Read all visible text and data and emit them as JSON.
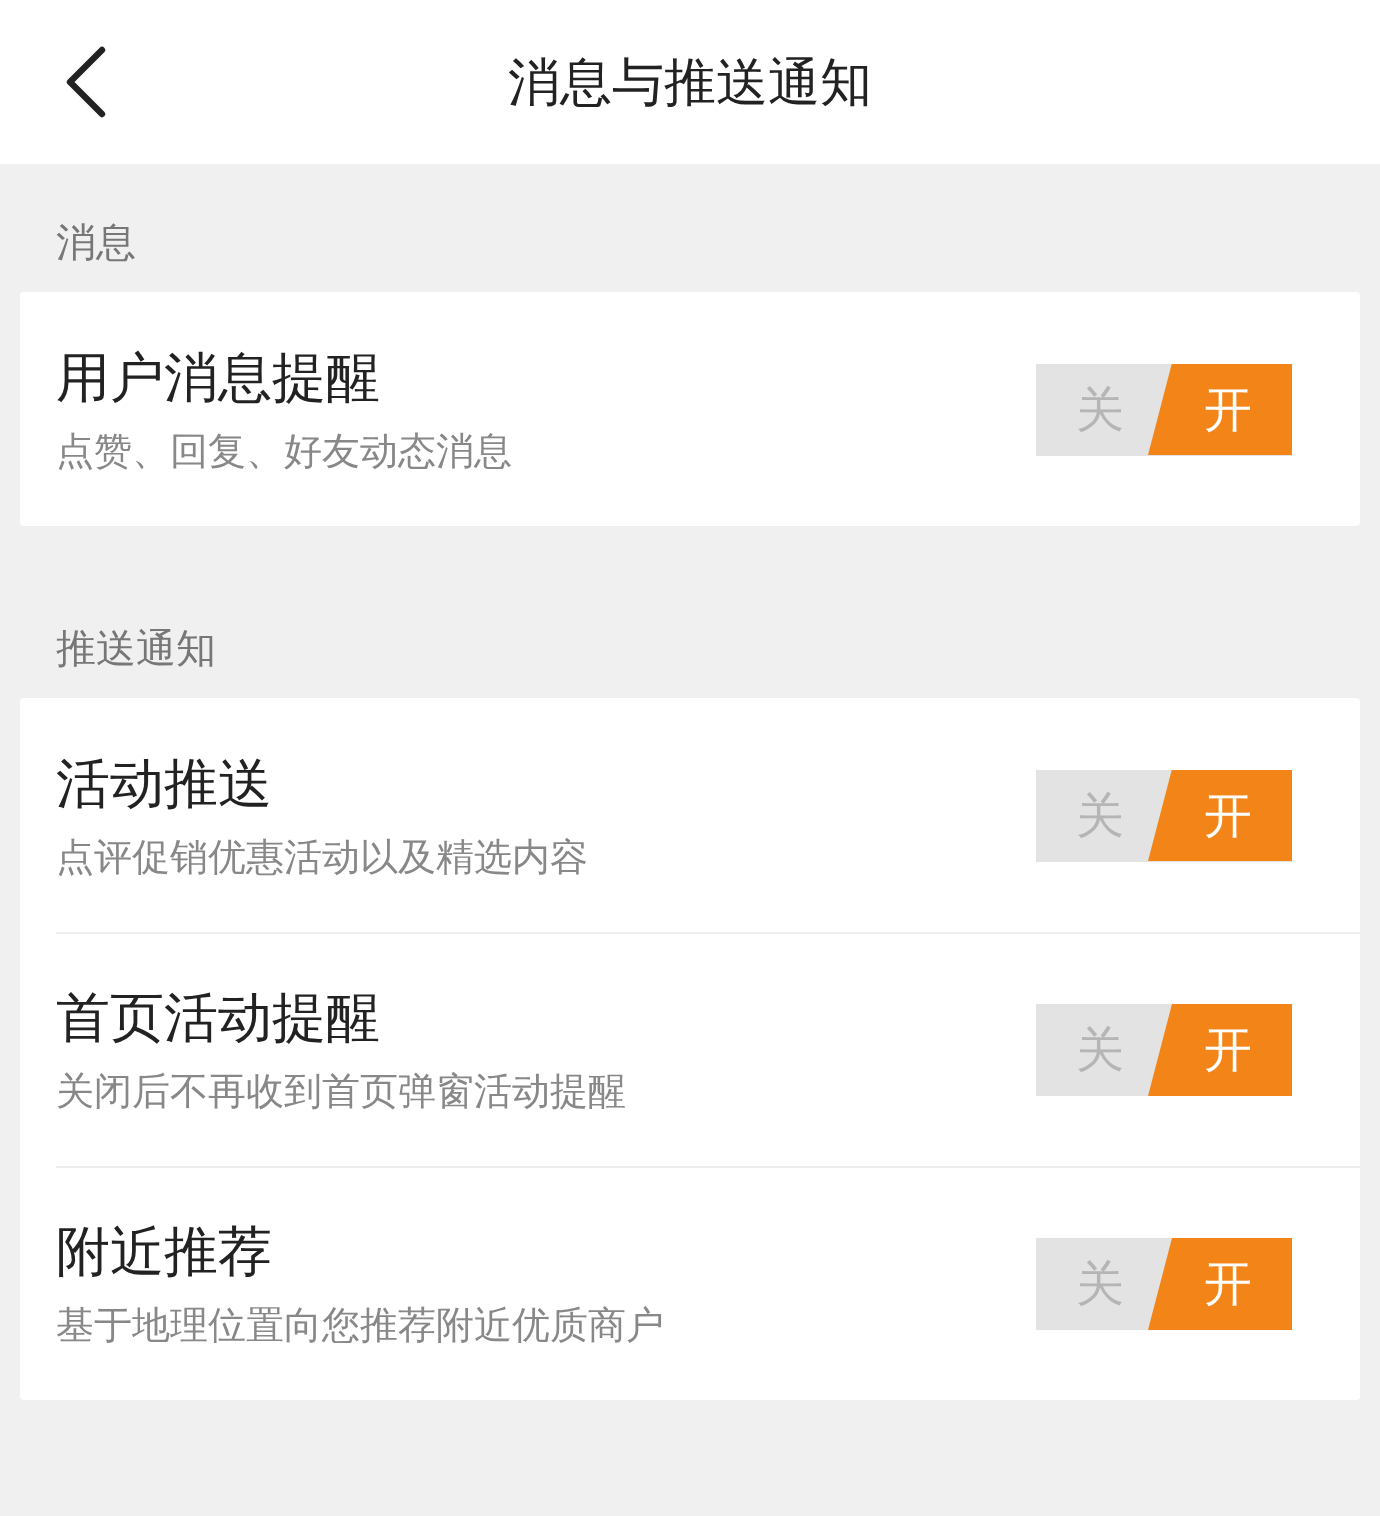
{
  "header": {
    "title": "消息与推送通知"
  },
  "sections": [
    {
      "title": "消息",
      "items": [
        {
          "title": "用户消息提醒",
          "subtitle": "点赞、回复、好友动态消息",
          "toggle": {
            "off_label": "关",
            "on_label": "开",
            "on": true
          }
        }
      ]
    },
    {
      "title": "推送通知",
      "items": [
        {
          "title": "活动推送",
          "subtitle": "点评促销优惠活动以及精选内容",
          "toggle": {
            "off_label": "关",
            "on_label": "开",
            "on": true
          }
        },
        {
          "title": "首页活动提醒",
          "subtitle": "关闭后不再收到首页弹窗活动提醒",
          "toggle": {
            "off_label": "关",
            "on_label": "开",
            "on": true
          }
        },
        {
          "title": "附近推荐",
          "subtitle": "基于地理位置向您推荐附近优质商户",
          "toggle": {
            "off_label": "关",
            "on_label": "开",
            "on": true
          }
        }
      ]
    }
  ]
}
